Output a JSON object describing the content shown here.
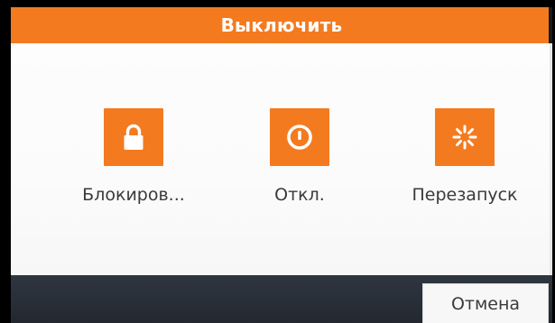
{
  "dialog": {
    "title": "Выключить",
    "accent_color": "#f47a1f"
  },
  "options": [
    {
      "label": "Блокиров...",
      "icon": "lock-icon"
    },
    {
      "label": "Откл.",
      "icon": "power-icon"
    },
    {
      "label": "Перезапуск",
      "icon": "restart-icon"
    }
  ],
  "footer": {
    "cancel_label": "Отмена"
  }
}
